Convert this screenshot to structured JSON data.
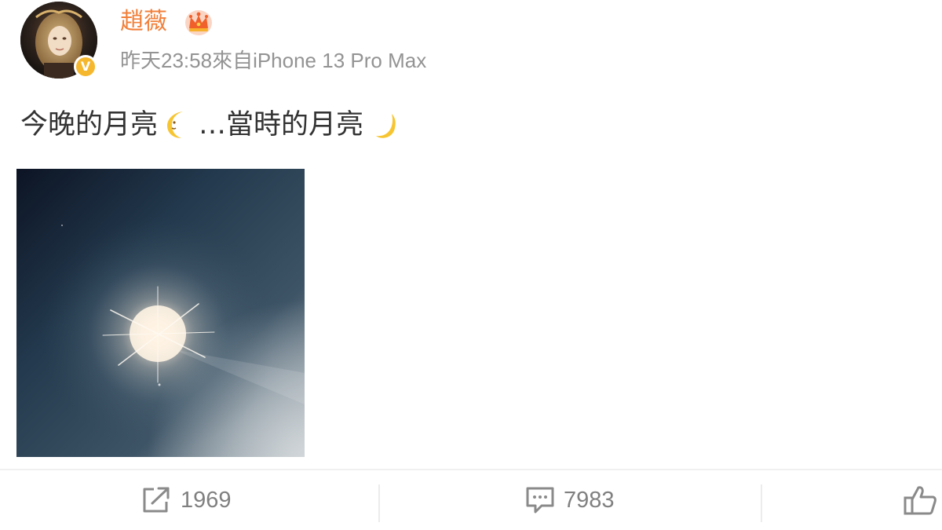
{
  "user": {
    "name": "趙薇",
    "verified_badge": "V",
    "crown_icon": "crown-icon",
    "name_color": "#f1803b"
  },
  "meta": {
    "text": "昨天23:58來自iPhone 13 Pro Max"
  },
  "post": {
    "text_part1": "今晚的月亮",
    "moon_icon_1": "crescent-moon-face-icon",
    "text_part2": "…當時的月亮",
    "moon_icon_2": "crescent-moon-icon",
    "photo": "night-sky-moon-photo"
  },
  "actions": {
    "repost_count": "1969",
    "comment_count": "7983",
    "repost_icon": "repost-icon",
    "comment_icon": "comment-icon",
    "like_icon": "thumbs-up-icon"
  }
}
